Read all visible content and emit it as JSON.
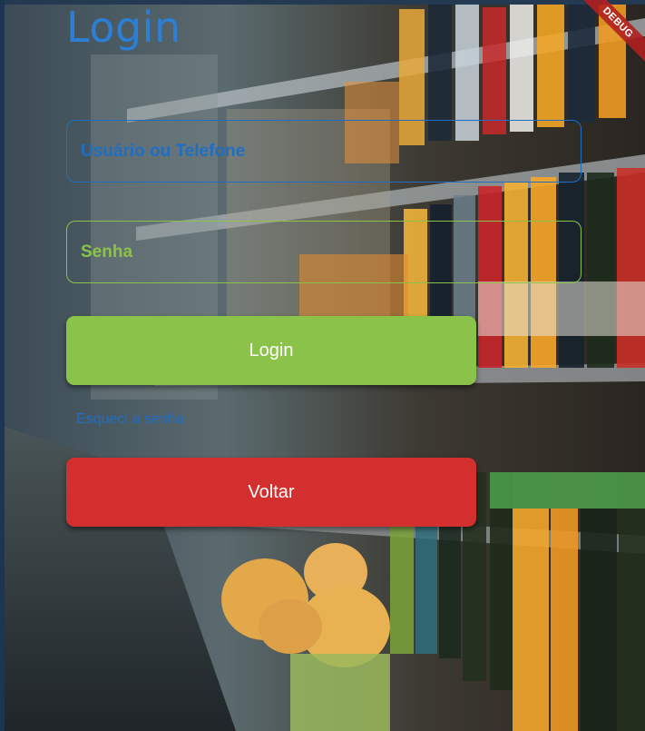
{
  "page": {
    "title": "Login"
  },
  "form": {
    "username_placeholder": "Usuário ou Telefone",
    "password_placeholder": "Senha"
  },
  "actions": {
    "login_label": "Login",
    "forgot_label": "Esqueci a senha",
    "back_label": "Voltar"
  },
  "banner": {
    "debug_label": "DEBUG"
  },
  "colors": {
    "title_blue": "#2b7fd6",
    "field_blue": "#1f6ec4",
    "accent_green": "#8bc34a",
    "danger_red": "#d32f2f"
  },
  "icons": {
    "background": "supermarket-shelves-photo"
  }
}
